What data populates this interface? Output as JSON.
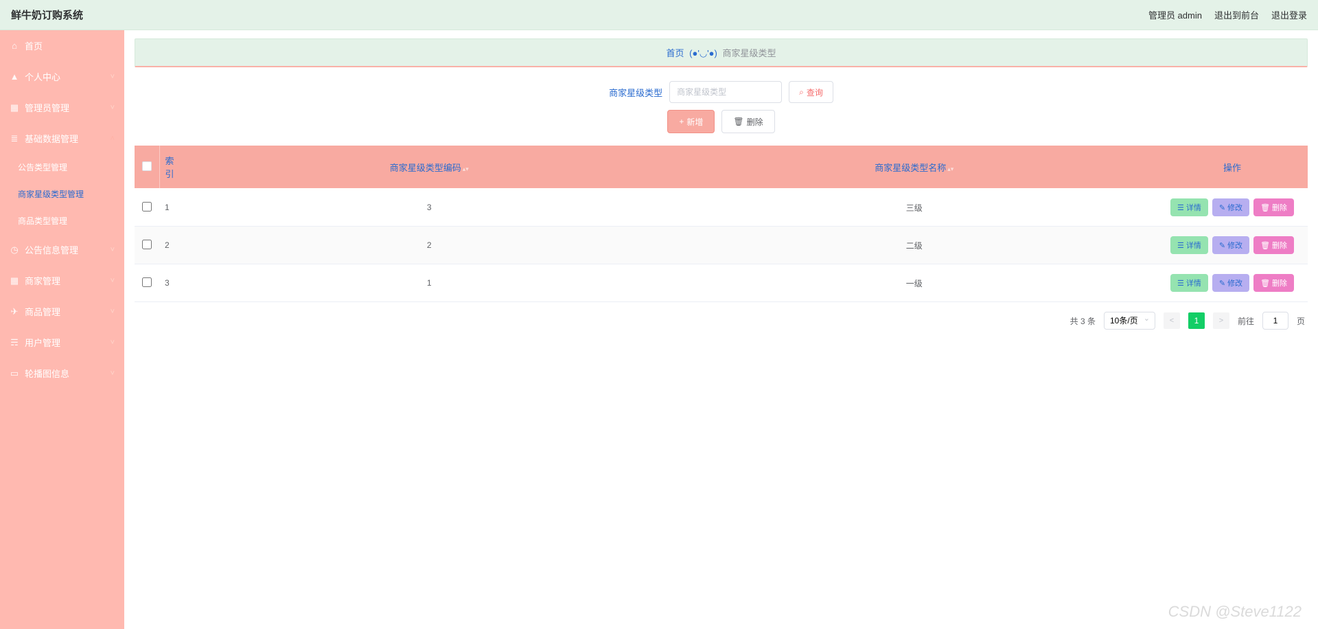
{
  "header": {
    "title": "鲜牛奶订购系统",
    "admin_label": "管理员 admin",
    "back_to_front": "退出到前台",
    "logout": "退出登录"
  },
  "sidebar": {
    "items": [
      {
        "icon": "home",
        "label": "首页",
        "chevron": false
      },
      {
        "icon": "user",
        "label": "个人中心",
        "chevron": true
      },
      {
        "icon": "dashboard",
        "label": "管理员管理",
        "chevron": true
      },
      {
        "icon": "layers",
        "label": "基础数据管理",
        "chevron": true,
        "open": true,
        "children": [
          {
            "label": "公告类型管理"
          },
          {
            "label": "商家星级类型管理",
            "active": true
          },
          {
            "label": "商品类型管理"
          }
        ]
      },
      {
        "icon": "clock",
        "label": "公告信息管理",
        "chevron": true
      },
      {
        "icon": "grid",
        "label": "商家管理",
        "chevron": true
      },
      {
        "icon": "send",
        "label": "商品管理",
        "chevron": true
      },
      {
        "icon": "cart",
        "label": "用户管理",
        "chevron": true
      },
      {
        "icon": "image",
        "label": "轮播图信息",
        "chevron": true
      }
    ]
  },
  "breadcrumb": {
    "home": "首页",
    "face": "(●'◡'●)",
    "current": "商家星级类型"
  },
  "search": {
    "label": "商家星级类型",
    "placeholder": "商家星级类型",
    "query_label": "查询"
  },
  "toolbar": {
    "add_label": "新增",
    "delete_label": "删除"
  },
  "table": {
    "headers": {
      "index": "索引",
      "code": "商家星级类型编码",
      "name": "商家星级类型名称",
      "ops": "操作"
    },
    "rows": [
      {
        "index": "1",
        "code": "3",
        "name": "三级"
      },
      {
        "index": "2",
        "code": "2",
        "name": "二级"
      },
      {
        "index": "3",
        "code": "1",
        "name": "一级"
      }
    ],
    "row_actions": {
      "detail": "详情",
      "edit": "修改",
      "delete": "删除"
    }
  },
  "pagination": {
    "total_text": "共 3 条",
    "page_size_label": "10条/页",
    "current_page": "1",
    "goto_prefix": "前往",
    "goto_value": "1",
    "goto_suffix": "页"
  },
  "watermark": "CSDN @Steve1122"
}
